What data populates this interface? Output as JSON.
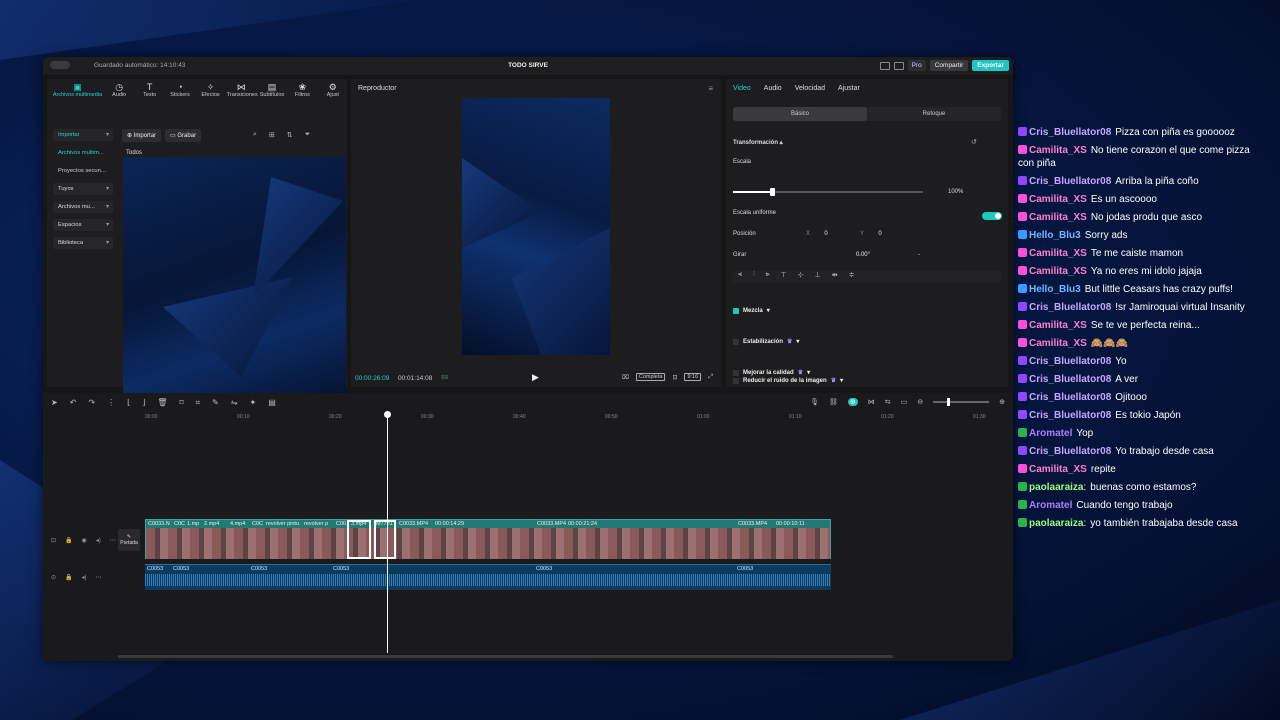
{
  "window": {
    "autosave": "Guardado automático: 14:10:43",
    "project": "TODO SIRVE",
    "pro": "Pro",
    "share": "Compartir",
    "export": "Exportar"
  },
  "mediatabs": [
    {
      "icon": "media-icon",
      "label": "Archivos multimedia",
      "glyph": "▣"
    },
    {
      "icon": "audio-icon",
      "label": "Audio",
      "glyph": "◷"
    },
    {
      "icon": "text-icon",
      "label": "Texto",
      "glyph": "T"
    },
    {
      "icon": "stickers-icon",
      "label": "Stickers",
      "glyph": "◔"
    },
    {
      "icon": "effects-icon",
      "label": "Efectos",
      "glyph": "✧"
    },
    {
      "icon": "transitions-icon",
      "label": "Transiciones",
      "glyph": "⋈"
    },
    {
      "icon": "subtitles-icon",
      "label": "Subtítulos",
      "glyph": "▤"
    },
    {
      "icon": "filters-icon",
      "label": "Filtros",
      "glyph": "❀"
    },
    {
      "icon": "adjust-icon",
      "label": "Ajust",
      "glyph": "⚙"
    }
  ],
  "sidenav": [
    "Importar",
    "Archivos multim...",
    "Proyectos secun...",
    "Tuyos",
    "Archivos mu...",
    "Espacios",
    "Biblioteca"
  ],
  "media": {
    "import": "Importar",
    "record": "Grabar",
    "all": "Todos"
  },
  "player": {
    "title": "Reproductor",
    "current": "00:00:26:09",
    "total": "00:01:14:08",
    "complete": "Completa",
    "ratio": "9:16"
  },
  "props": {
    "tabs": [
      "Video",
      "Audio",
      "Velocidad",
      "Ajustar"
    ],
    "basic": "Básico",
    "retouch": "Retoque",
    "transform": "Transformación",
    "scale": "Escala",
    "scale_val": "100%",
    "uniform": "Escala uniforme",
    "position": "Posición",
    "x_label": "X",
    "x": "0",
    "y_label": "Y",
    "y": "0",
    "rotate": "Girar",
    "rotate_val": "0.00°",
    "rotate_dash": "-",
    "blend": "Mezcla",
    "stabilization": "Estabilización",
    "improve": "Mejorar la calidad",
    "noise": "Reducir el ruido de la imagen"
  },
  "timeline": {
    "ruler": [
      "00:00",
      "00:10",
      "00:20",
      "00:30",
      "00:40",
      "00:50",
      "01:00",
      "01:10",
      "01:20",
      "01:30"
    ],
    "cover": "Portada",
    "vclips": [
      "C0033.N",
      "C0C",
      "1.mp",
      "2.mp4",
      "4.mp4",
      "C0C",
      "revolver pintu",
      "revolver p",
      "C00",
      "3.mp4",
      "M7731",
      "C0033.MP4",
      "00:00:14:29",
      "C0033.MP4",
      "00:00:21:24",
      "C0033.MP4",
      "00:00:10:11"
    ],
    "aclips": [
      "C0053",
      "C0053",
      "C0053",
      "C0053",
      "C0053",
      "C0053"
    ]
  },
  "chat": [
    {
      "user": "Cris_Bluellator08",
      "color": "#c7a6ff",
      "badge": "#9146ff",
      "text": "Pizza con piña es goooooz"
    },
    {
      "user": "Camilita_XS",
      "color": "#ff7fd0",
      "badge": "#ff4fd8",
      "text": "No tiene corazon el que come pizza con piña"
    },
    {
      "user": "Cris_Bluellator08",
      "color": "#c7a6ff",
      "badge": "#9146ff",
      "text": "Arriba la piña coño"
    },
    {
      "user": "Camilita_XS",
      "color": "#ff7fd0",
      "badge": "#ff4fd8",
      "text": "Es un ascoooo"
    },
    {
      "user": "Camilita_XS",
      "color": "#ff7fd0",
      "badge": "#ff4fd8",
      "text": "No jodas produ que asco"
    },
    {
      "user": "Hello_Blu3",
      "color": "#6fb8ff",
      "badge": "#3a9bff",
      "text": "Sorry ads"
    },
    {
      "user": "Camilita_XS",
      "color": "#ff7fd0",
      "badge": "#ff4fd8",
      "text": "Te me caiste mamon"
    },
    {
      "user": "Camilita_XS",
      "color": "#ff7fd0",
      "badge": "#ff4fd8",
      "text": "Ya no eres mi idolo jajaja"
    },
    {
      "user": "Hello_Blu3",
      "color": "#6fb8ff",
      "badge": "#3a9bff",
      "text": "But little Ceasars has crazy puffs!"
    },
    {
      "user": "Cris_Bluellator08",
      "color": "#c7a6ff",
      "badge": "#9146ff",
      "text": "!sr Jamiroquai virtual Insanity"
    },
    {
      "user": "Camilita_XS",
      "color": "#ff7fd0",
      "badge": "#ff4fd8",
      "text": "Se te ve perfecta reina..."
    },
    {
      "user": "Camilita_XS",
      "color": "#ff7fd0",
      "badge": "#ff4fd8",
      "text": "🙈🙈🙈"
    },
    {
      "user": "Cris_Bluellator08",
      "color": "#c7a6ff",
      "badge": "#9146ff",
      "text": "Yo"
    },
    {
      "user": "Cris_Bluellator08",
      "color": "#c7a6ff",
      "badge": "#9146ff",
      "text": "A ver"
    },
    {
      "user": "Cris_Bluellator08",
      "color": "#c7a6ff",
      "badge": "#9146ff",
      "text": "Ojitooo"
    },
    {
      "user": "Cris_Bluellator08",
      "color": "#c7a6ff",
      "badge": "#9146ff",
      "text": "Es tokio Japón"
    },
    {
      "user": "Aromatel",
      "color": "#b07cff",
      "badge": "#28b34f",
      "text": "Yop"
    },
    {
      "user": "Cris_Bluellator08",
      "color": "#c7a6ff",
      "badge": "#9146ff",
      "text": "Yo trabajo desde casa"
    },
    {
      "user": "Camilita_XS",
      "color": "#ff7fd0",
      "badge": "#ff4fd8",
      "text": "repite"
    },
    {
      "user": "paolaaraiza",
      "color": "#9dff7a",
      "badge": "#28b34f",
      "text": "buenas como estamos?"
    },
    {
      "user": "Aromatel",
      "color": "#b07cff",
      "badge": "#28b34f",
      "text": "Cuando tengo trabajo"
    },
    {
      "user": "paolaaraiza",
      "color": "#9dff7a",
      "badge": "#28b34f",
      "text": "yo también trabajaba desde casa"
    }
  ]
}
